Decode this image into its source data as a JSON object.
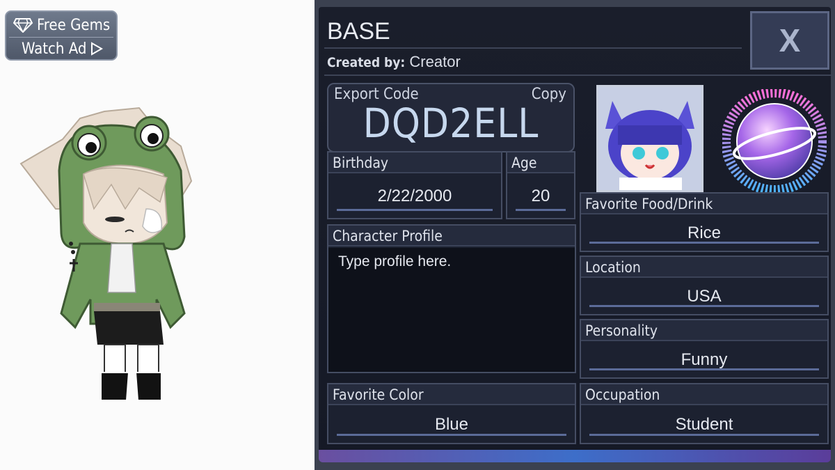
{
  "gems_button": {
    "line1": "Free Gems",
    "line2": "Watch Ad",
    "gem_icon": "diamond-icon",
    "play_icon": "play-icon"
  },
  "profile": {
    "title": "BASE",
    "created_by_label": "Created by:",
    "creator": "Creator",
    "close_label": "X",
    "export": {
      "label": "Export Code",
      "copy_label": "Copy",
      "code": "DQD2ELL"
    },
    "birthday": {
      "label": "Birthday",
      "value": "2/22/2000"
    },
    "age": {
      "label": "Age",
      "value": "20"
    },
    "character_profile": {
      "label": "Character Profile",
      "placeholder": "Type profile here."
    },
    "favorite_color": {
      "label": "Favorite Color",
      "value": "Blue"
    },
    "favorite_food": {
      "label": "Favorite Food/Drink",
      "value": "Rice"
    },
    "location": {
      "label": "Location",
      "value": "USA"
    },
    "personality": {
      "label": "Personality",
      "value": "Funny"
    },
    "occupation": {
      "label": "Occupation",
      "value": "Student"
    }
  },
  "colors": {
    "panel_bg": "#1a1e2b",
    "accent": "#5b6b98",
    "frog_green": "#6f9a5c"
  }
}
